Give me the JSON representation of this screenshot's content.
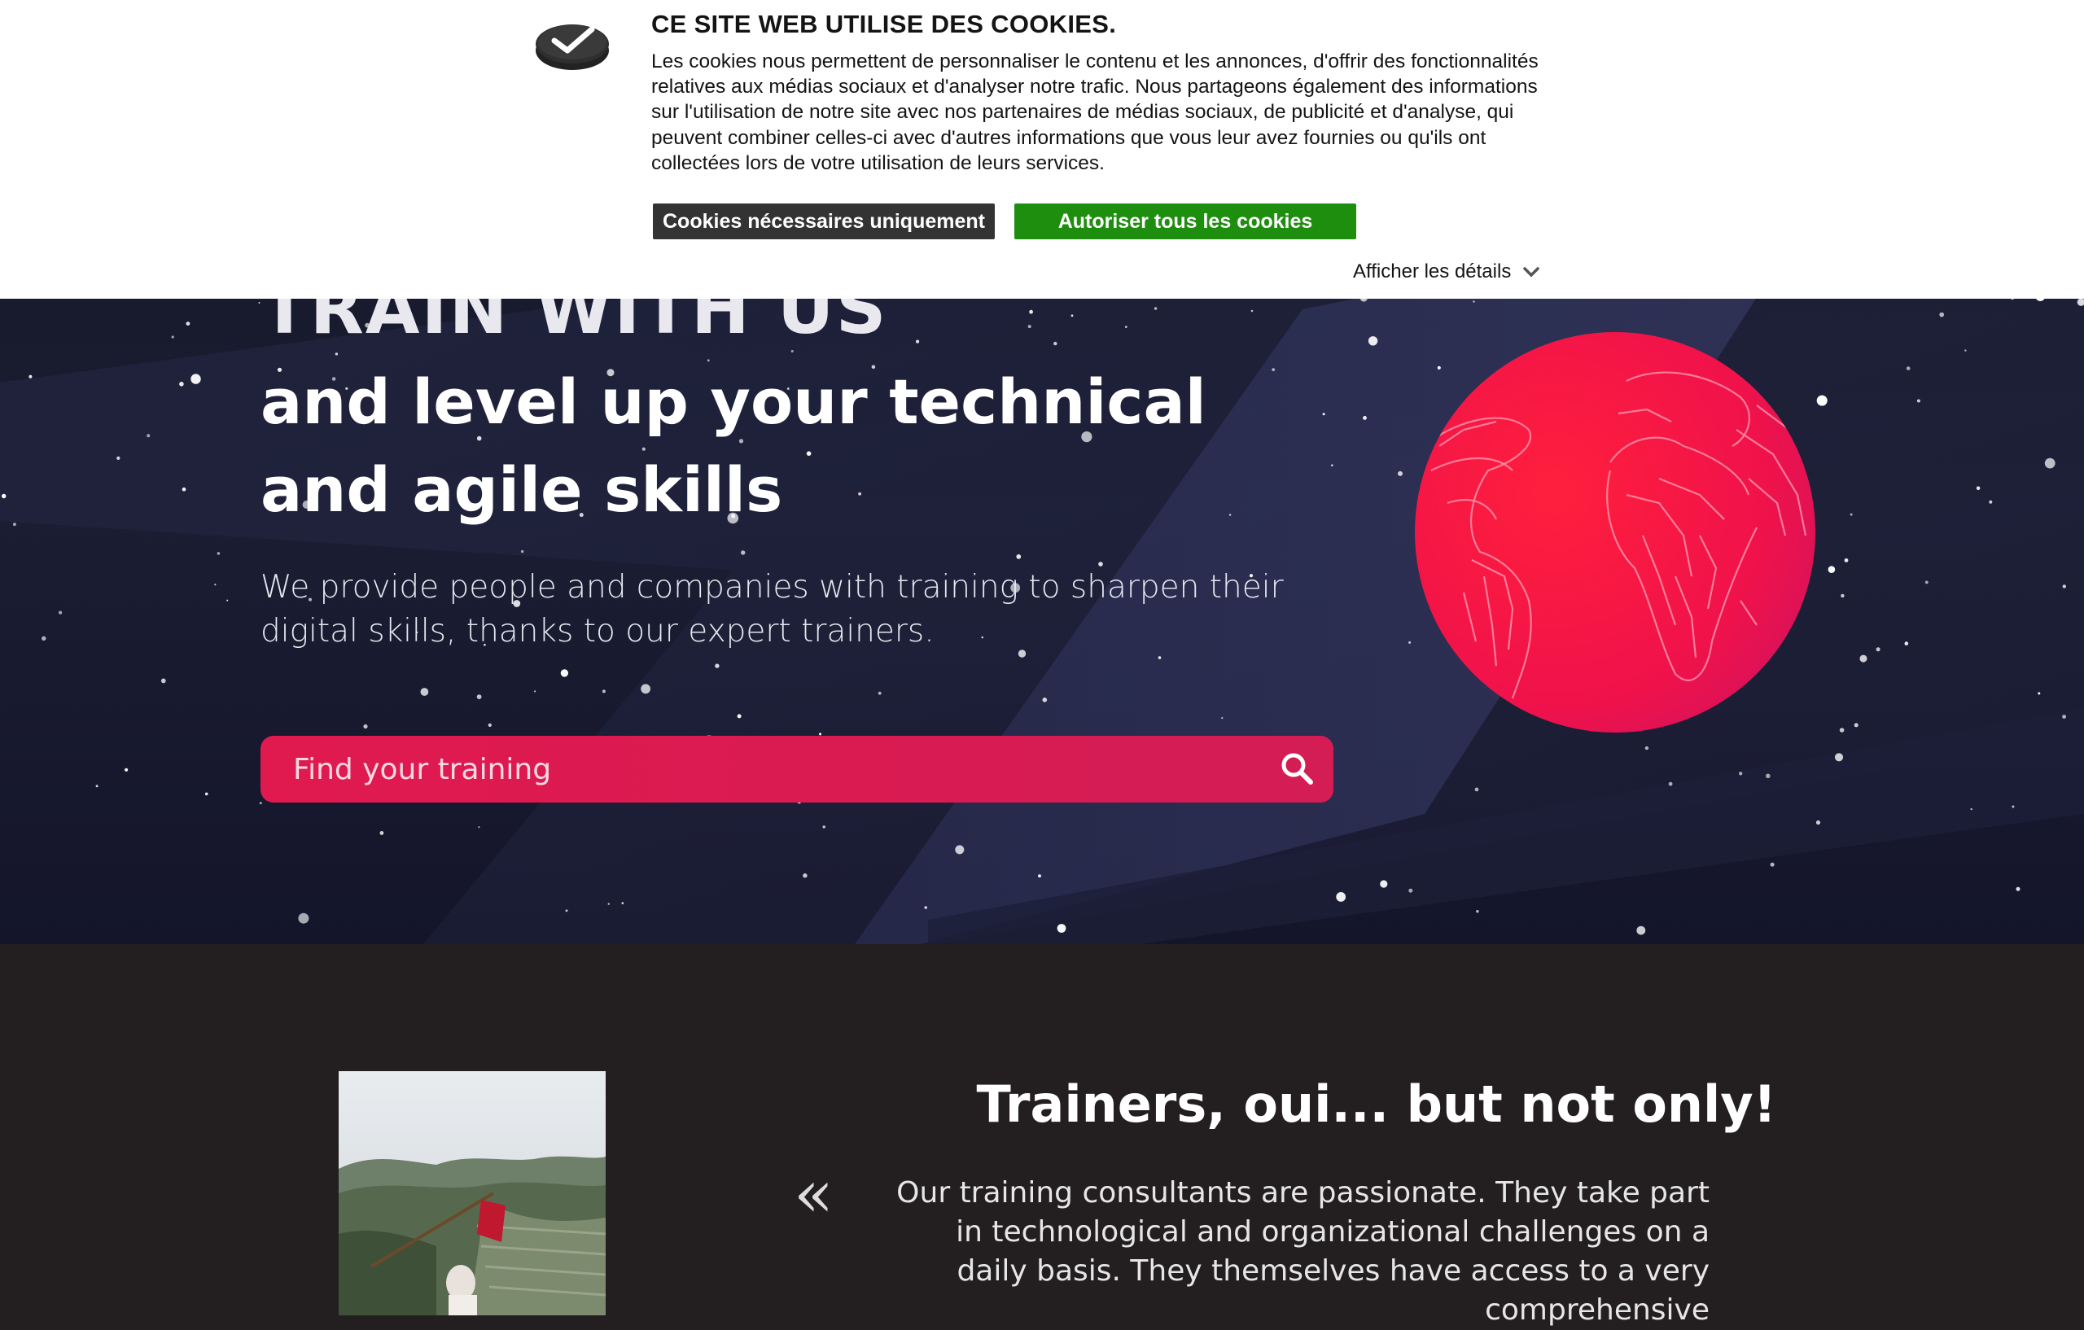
{
  "cookie_banner": {
    "title": "CE SITE WEB UTILISE DES COOKIES.",
    "text": "Les cookies nous permettent de personnaliser le contenu et les annonces, d'offrir des fonctionnalités relatives aux médias sociaux et d'analyser notre trafic. Nous partageons également des informations sur l'utilisation de notre site avec nos partenaires de médias sociaux, de publicité et d'analyse, qui peuvent combiner celles-ci avec d'autres informations que vous leur avez fournies ou qu'ils ont collectées lors de votre utilisation de leurs services.",
    "necessary_button": "Cookies nécessaires uniquement",
    "allow_button": "Autoriser tous les cookies",
    "details_link": "Afficher les détails",
    "logo_icon": "cookiebot-check-logo",
    "details_icon": "chevron-down-icon"
  },
  "hero": {
    "title": "TRAIN WITH US",
    "subtitle": "and level up your technical and agile skills",
    "description": "We provide people and companies with training to sharpen their digital skills, thanks to our expert trainers.",
    "search": {
      "placeholder": "Find your training",
      "icon": "search-icon"
    },
    "globe_icon": "circuit-globe"
  },
  "testimonial": {
    "title": "Trainers, oui... but not only!",
    "quote_mark": "«",
    "text": "Our training consultants are passionate. They take part in technological and organizational challenges on a daily basis. They themselves have access to a very comprehensive"
  },
  "colors": {
    "accent": "#e01a4f",
    "cookie_allow": "#1e8e0e",
    "cookie_necessary": "#333333",
    "hero_bg": "#161829",
    "section_bg": "#231f20"
  }
}
